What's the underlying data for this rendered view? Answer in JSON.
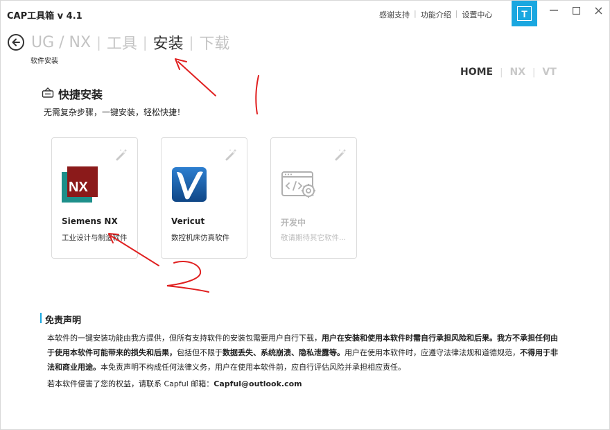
{
  "window": {
    "title": "CAP工具箱 v 4.1",
    "top_links": [
      "感谢支持",
      "功能介绍",
      "设置中心"
    ],
    "badge": "T",
    "controls": {
      "minimize": "—",
      "maximize": "☐",
      "close": "✕"
    }
  },
  "breadcrumb": {
    "items": [
      {
        "label": "UG / NX",
        "active": false
      },
      {
        "label": "工具",
        "active": false
      },
      {
        "label": "安装",
        "active": true
      },
      {
        "label": "下载",
        "active": false
      }
    ],
    "subtitle": "软件安装"
  },
  "mini_nav": [
    {
      "label": "HOME",
      "active": true
    },
    {
      "label": "NX",
      "active": false
    },
    {
      "label": "VT",
      "active": false
    }
  ],
  "quick_install": {
    "title": "快捷安装",
    "description": "无需复杂步骤，一键安装，轻松快捷！",
    "cards": [
      {
        "name": "Siemens NX",
        "info": "工业设计与制造软件",
        "logo_text": "NX",
        "disabled": false
      },
      {
        "name": "Vericut",
        "info": "数控机床仿真软件",
        "logo_text": "V",
        "disabled": false
      },
      {
        "name": "开发中",
        "info": "敬请期待其它软件...",
        "disabled": true
      }
    ]
  },
  "disclaimer": {
    "title": "免责声明",
    "p1": "本软件的一键安装功能由我方提供，但所有支持软件的安装包需要用户自行下载，",
    "p1_bold": "用户在安装和使用本软件时需自行承担风险和后果。我方不承担任何由于使用本软件可能带来的损失和后果，",
    "p2": "包括但不限于",
    "p2_bold": "数据丢失、系统崩溃、隐私泄露等。",
    "p3": "用户在使用本软件时，应遵守法律法规和道德规范，",
    "p3_bold": "不得用于非法和商业用途。",
    "p4": "本免责声明不构成任何法律义务，用户在使用本软件前，应自行评估风险并承担相应责任。",
    "contact_prefix": "若本软件侵害了您的权益，请联系 Capful 邮箱：",
    "contact_email": "Capful@outlook.com"
  },
  "colors": {
    "accent": "#1aa7e0",
    "nx_red": "#8b1a1a",
    "nx_teal": "#1d8f8a",
    "vericut_blue": "#1a5ea8",
    "annotation_red": "#e02020"
  }
}
